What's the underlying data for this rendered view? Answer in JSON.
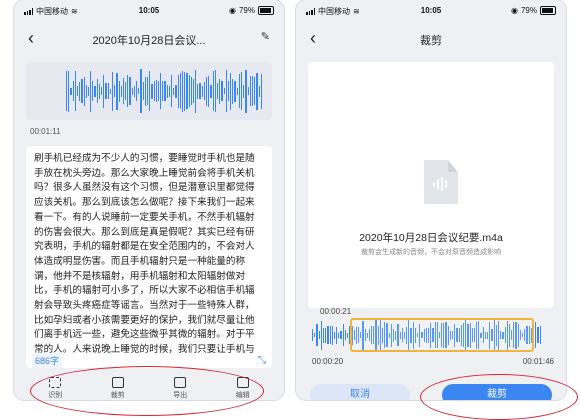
{
  "status_bar": {
    "carrier": "中国移动",
    "time": "10:05",
    "battery": "79%"
  },
  "left_screen": {
    "title": "2020年10月28日会议...",
    "timestamp": "00:01:11",
    "transcript": "刷手机已经成为不少人的习惯，要睡觉时手机也是随手放在枕头旁边。那么大家晚上睡觉前会将手机关机吗？很多人虽然没有这个习惯，但是潜意识里都觉得应该关机。那么到底该怎么做呢？接下来我们一起来看一下。有的人说睡前一定要关手机，不然手机辐射的伤害会很大。那么到底是真是假呢？其实已经有研究表明，手机的辐射都是在安全范围内的，不会对人体造成明显伤害。而且手机辐射只是一种能量的称谓，他并不是核辐射，用手机辐射和太阳辐射做对比，手机的辐射可小多了，所以大家不必相信手机辐射会导致头疼癌症等谣言。当然对于一些特殊人群，比如孕妇或者小孩需要更好的保护，我们就尽量让他们离手机远一些，避免这些微乎其微的辐射。对于平常的人。人来说晚上睡觉的时候，我们只要让手机与我",
    "char_count": "686字",
    "tools": [
      {
        "icon": "scan-icon",
        "label": "识别"
      },
      {
        "icon": "crop-icon",
        "label": "裁剪"
      },
      {
        "icon": "document-icon",
        "label": "导出"
      },
      {
        "icon": "edit-icon",
        "label": "编辑"
      }
    ]
  },
  "right_screen": {
    "title": "裁剪",
    "file_name": "2020年10月28日会议纪要.m4a",
    "hint": "裁剪会生成新的音频，不会对原音频造成影响",
    "trim_start": "00:00:21",
    "time_left": "00:00:20",
    "time_right": "00:01:46",
    "cancel_label": "取消",
    "confirm_label": "裁剪"
  },
  "colors": {
    "accent": "#3b86f2",
    "annotation": "#d8262e",
    "handle": "#f3b43c"
  }
}
